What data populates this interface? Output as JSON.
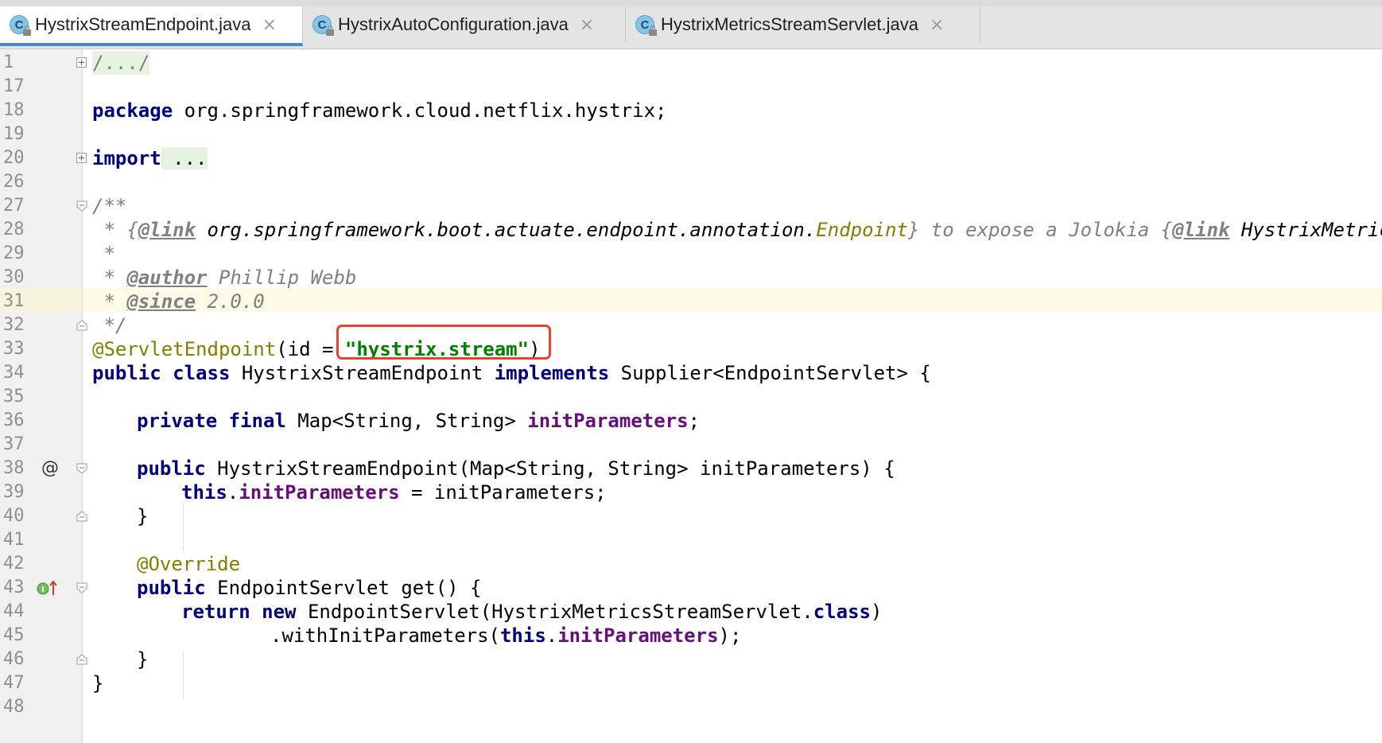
{
  "tabs": [
    {
      "label": "HystrixStreamEndpoint.java",
      "icon": "class-icon",
      "close": "×"
    },
    {
      "label": "HystrixAutoConfiguration.java",
      "icon": "class-icon",
      "close": "×"
    },
    {
      "label": "HystrixMetricsStreamServlet.java",
      "icon": "class-icon",
      "close": "×"
    }
  ],
  "class_icon_letter": "C",
  "line_numbers": [
    "1",
    "17",
    "18",
    "19",
    "20",
    "26",
    "27",
    "28",
    "29",
    "30",
    "31",
    "32",
    "33",
    "34",
    "35",
    "36",
    "37",
    "38",
    "39",
    "40",
    "41",
    "42",
    "43",
    "44",
    "45",
    "46",
    "47",
    "48"
  ],
  "code": {
    "l1": "/.../",
    "l18_kw": "package",
    "l18_rest": " org.springframework.cloud.netflix.hystrix;",
    "l20_kw": "import",
    "l20_rest": " ...",
    "l27": "/**",
    "l28_a": " * {",
    "l28_link1": "@link",
    "l28_b": " org.springframework.boot.actuate.endpoint.annotation.",
    "l28_endpoint": "Endpoint",
    "l28_c": "} to expose a Jolokia {",
    "l28_link2": "@link",
    "l28_d": " HystrixMetricsSt",
    "l29": " *",
    "l30_a": " * ",
    "l30_tag": "@author",
    "l30_b": " Phillip Webb",
    "l31_a": " * ",
    "l31_tag": "@since",
    "l31_b": " 2.0.0",
    "l32": " */",
    "l33_ann": "@ServletEndpoint",
    "l33_a": "(id = ",
    "l33_str": "\"hystrix.stream\"",
    "l33_b": ")",
    "l34_kw1": "public class",
    "l34_a": " HystrixStreamEndpoint ",
    "l34_kw2": "implements",
    "l34_b": " Supplier<EndpointServlet> {",
    "l36_kw": "private final",
    "l36_a": " Map<String, String> ",
    "l36_fld": "initParameters",
    "l36_b": ";",
    "l38_kw": "public",
    "l38_a": " HystrixStreamEndpoint(Map<String, String> initParameters) {",
    "l39_kw": "this",
    "l39_a": ".",
    "l39_fld": "initParameters",
    "l39_b": " = initParameters;",
    "l40": "}",
    "l42_ann": "@Override",
    "l43_kw": "public",
    "l43_a": " EndpointServlet get() {",
    "l44_kw1": "return new",
    "l44_a": " EndpointServlet(HystrixMetricsStreamServlet.",
    "l44_kw2": "class",
    "l44_b": ")",
    "l45_a": ".withInitParameters(",
    "l45_kw": "this",
    "l45_b": ".",
    "l45_fld": "initParameters",
    "l45_c": ");",
    "l46": "}",
    "l47": "}"
  },
  "gutter_marks": {
    "override_marker": "@",
    "implements_marker": "I↑"
  },
  "colors": {
    "keyword": "#000080",
    "string": "#008000",
    "annotation": "#808000",
    "field": "#660e7a",
    "comment": "#808080",
    "highlight_box": "#e8432e",
    "active_tab_underline": "#4a88c7"
  }
}
